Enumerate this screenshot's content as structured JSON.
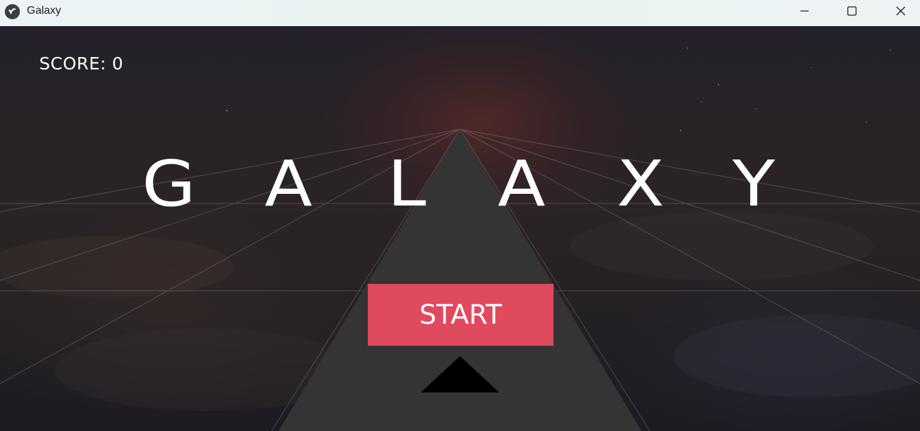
{
  "window": {
    "title": "Galaxy",
    "icon": "kivy-app-icon",
    "controls": [
      "minimize-icon",
      "maximize-icon",
      "close-icon"
    ]
  },
  "hud": {
    "score_label": "SCORE: 0"
  },
  "menu": {
    "title_letters": [
      "G",
      "A",
      "L",
      "A",
      "X",
      "Y"
    ],
    "start_label": "START"
  },
  "colors": {
    "start_button": "#e04a5e",
    "track": "#343434",
    "ship": "#000000",
    "text": "#ffffff"
  }
}
